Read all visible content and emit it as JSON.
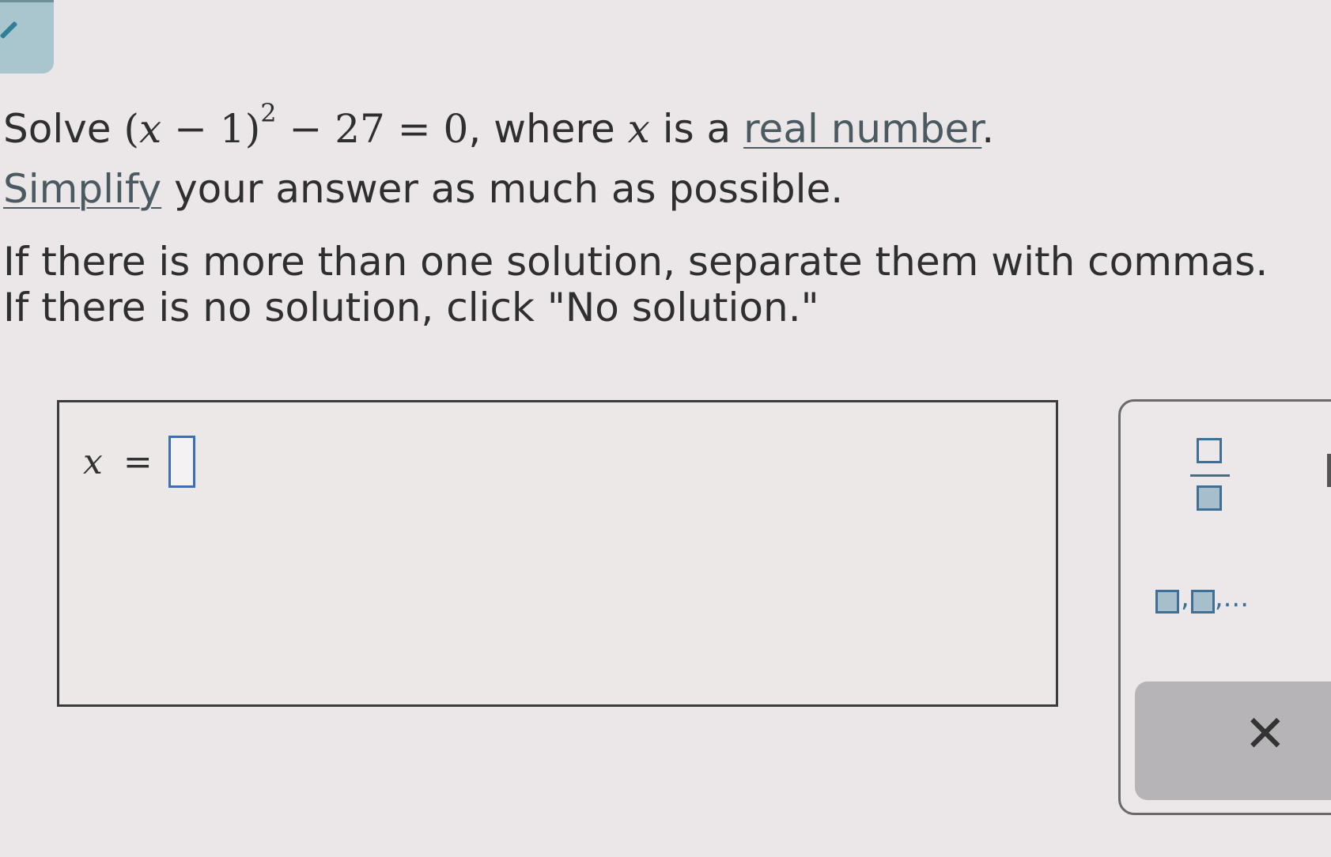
{
  "question": {
    "solve_word": "Solve",
    "eq_open": "(",
    "eq_var": "x",
    "eq_minus_one": " − 1)",
    "eq_exponent": "2",
    "eq_rest": " − 27 = 0",
    "comma_where": ", where ",
    "where_var": "x",
    "is_a": " is a ",
    "real_number_link": "real number",
    "period": ".",
    "simplify_link": "Simplify",
    "simplify_rest": " your answer as much as possible."
  },
  "instructions": {
    "line1": "If there is more than one solution, separate them with commas.",
    "line2": "If there is no solution, click \"No solution.\""
  },
  "answer": {
    "variable": "x",
    "equals": "=",
    "value": ""
  },
  "tools": {
    "list_separator": ",",
    "list_ellipsis": ",...",
    "clear_symbol": "✕"
  },
  "colors": {
    "background": "#ebe7e8",
    "input_border": "#3d6fb8",
    "tool_accent": "#3f6f95",
    "clear_button_bg": "#b6b4b6"
  },
  "icons": {
    "collapse": "pencil-icon",
    "fraction": "fraction-template-icon",
    "list": "list-template-icon",
    "clear": "close-icon"
  }
}
